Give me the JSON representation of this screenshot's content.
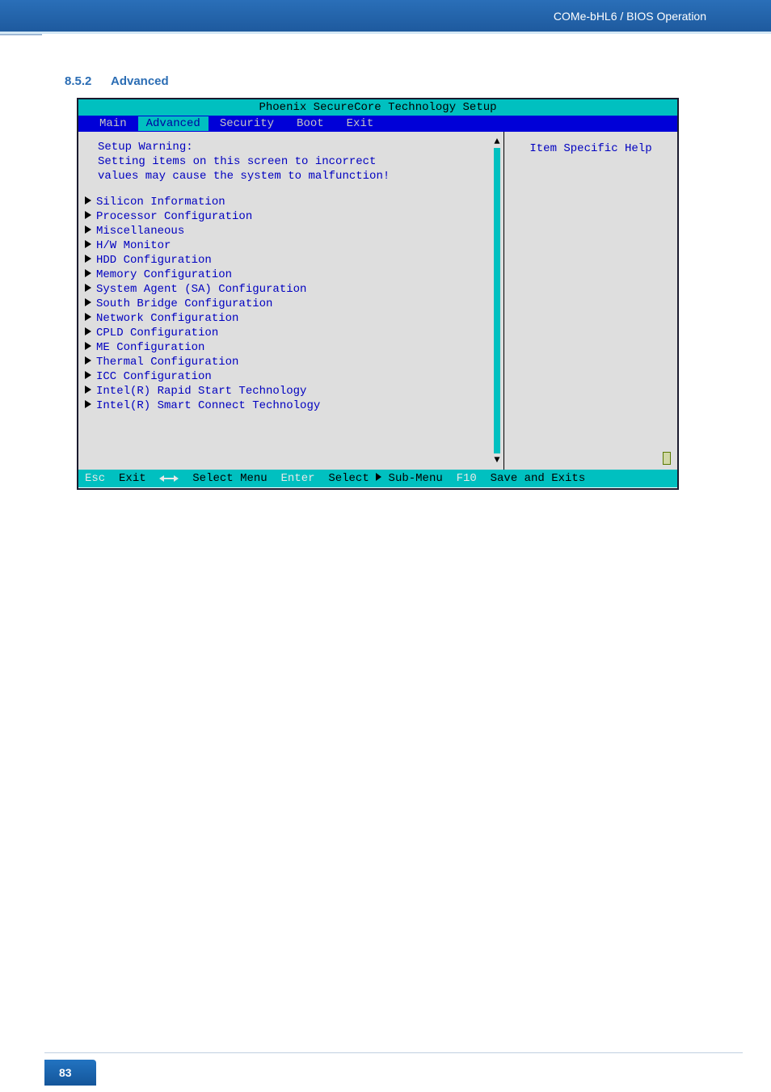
{
  "header": {
    "breadcrumb": "COMe-bHL6 / BIOS Operation"
  },
  "section": {
    "number": "8.5.2",
    "title": "Advanced"
  },
  "bios": {
    "title": "Phoenix SecureCore Technology Setup",
    "tabs": [
      "Main",
      "Advanced",
      "Security",
      "Boot",
      "Exit"
    ],
    "active_tab": "Advanced",
    "warning": {
      "title": "Setup Warning:",
      "line1": "Setting items on this screen to incorrect",
      "line2": "values may cause the system to malfunction!"
    },
    "menu": [
      "Silicon Information",
      "Processor Configuration",
      "Miscellaneous",
      "H/W Monitor",
      "HDD Configuration",
      "Memory Configuration",
      "System Agent (SA) Configuration",
      "South Bridge Configuration",
      "Network Configuration",
      "CPLD Configuration",
      "ME Configuration",
      "Thermal Configuration",
      "ICC Configuration",
      "Intel(R) Rapid Start Technology",
      "Intel(R) Smart Connect Technology"
    ],
    "help": {
      "title": "Item Specific Help"
    },
    "footer": {
      "esc_key": "Esc",
      "esc_label": "Exit",
      "arrows_label": "Select Menu",
      "enter_key": "Enter",
      "enter_label": "Select ",
      "submenu": "Sub-Menu",
      "f10_key": "F10",
      "f10_label": "Save and Exits"
    }
  },
  "page_number": "83"
}
